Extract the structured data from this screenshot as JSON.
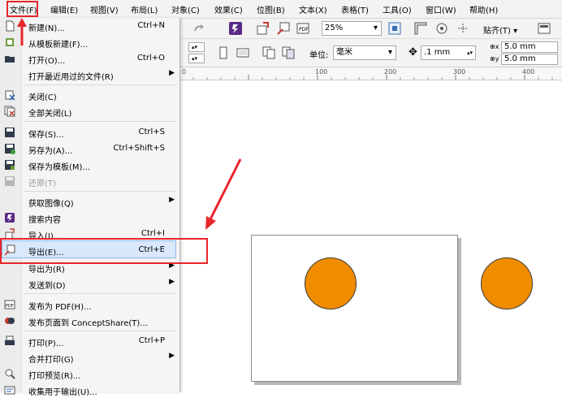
{
  "menubar": {
    "items": [
      "文件(F)",
      "编辑(E)",
      "视图(V)",
      "布局(L)",
      "对象(C)",
      "效果(C)",
      "位图(B)",
      "文本(X)",
      "表格(T)",
      "工具(O)",
      "窗口(W)",
      "帮助(H)"
    ]
  },
  "toolbar": {
    "zoom": "25%",
    "snap_label": "贴齐(T)",
    "units_label": "单位:",
    "units_value": "毫米",
    "nudge_value": ".1 mm",
    "dup_x": "5.0 mm",
    "dup_y": "5.0 mm",
    "x_label": "x",
    "y_label": "y"
  },
  "ruler": {
    "ticks": [
      "100",
      "200",
      "300",
      "400"
    ]
  },
  "file_menu": {
    "items": [
      {
        "label": "新建(N)...",
        "shortcut": "Ctrl+N",
        "icon": "new-document-icon"
      },
      {
        "label": "从模板新建(F)...",
        "shortcut": "",
        "icon": "template-icon"
      },
      {
        "label": "打开(O)...",
        "shortcut": "Ctrl+O",
        "icon": "open-folder-icon"
      },
      {
        "label": "打开最近用过的文件(R)",
        "shortcut": "",
        "submenu": true
      },
      {
        "label": "关闭(C)",
        "shortcut": "",
        "icon": "close-document-icon"
      },
      {
        "label": "全部关闭(L)",
        "shortcut": "",
        "icon": "close-all-icon"
      },
      {
        "label": "保存(S)...",
        "shortcut": "Ctrl+S",
        "icon": "save-icon"
      },
      {
        "label": "另存为(A)...",
        "shortcut": "Ctrl+Shift+S",
        "icon": "save-as-icon"
      },
      {
        "label": "保存为模板(M)...",
        "shortcut": "",
        "icon": "save-template-icon"
      },
      {
        "label": "还原(T)",
        "shortcut": "",
        "icon": "revert-icon",
        "disabled": true
      },
      {
        "label": "获取图像(Q)",
        "shortcut": "",
        "submenu": true
      },
      {
        "label": "搜索内容",
        "shortcut": "",
        "icon": "search-content-icon"
      },
      {
        "label": "导入(I)...",
        "shortcut": "Ctrl+I",
        "icon": "import-icon"
      },
      {
        "label": "导出(E)...",
        "shortcut": "Ctrl+E",
        "icon": "export-icon"
      },
      {
        "label": "导出为(R)",
        "shortcut": "",
        "submenu": true
      },
      {
        "label": "发送到(D)",
        "shortcut": "",
        "submenu": true
      },
      {
        "label": "发布为 PDF(H)...",
        "shortcut": "",
        "icon": "pdf-icon"
      },
      {
        "label": "发布页面到 ConceptShare(T)...",
        "shortcut": "",
        "icon": "conceptshare-icon"
      },
      {
        "label": "打印(P)...",
        "shortcut": "Ctrl+P",
        "icon": "print-icon"
      },
      {
        "label": "合并打印(G)",
        "shortcut": "",
        "submenu": true
      },
      {
        "label": "打印预览(R)...",
        "shortcut": "",
        "icon": "print-preview-icon"
      },
      {
        "label": "收集用于输出(U)...",
        "shortcut": "",
        "icon": "collect-output-icon"
      }
    ]
  },
  "colors": {
    "highlight": "#e8262b",
    "circle_fill": "#f08c00"
  }
}
